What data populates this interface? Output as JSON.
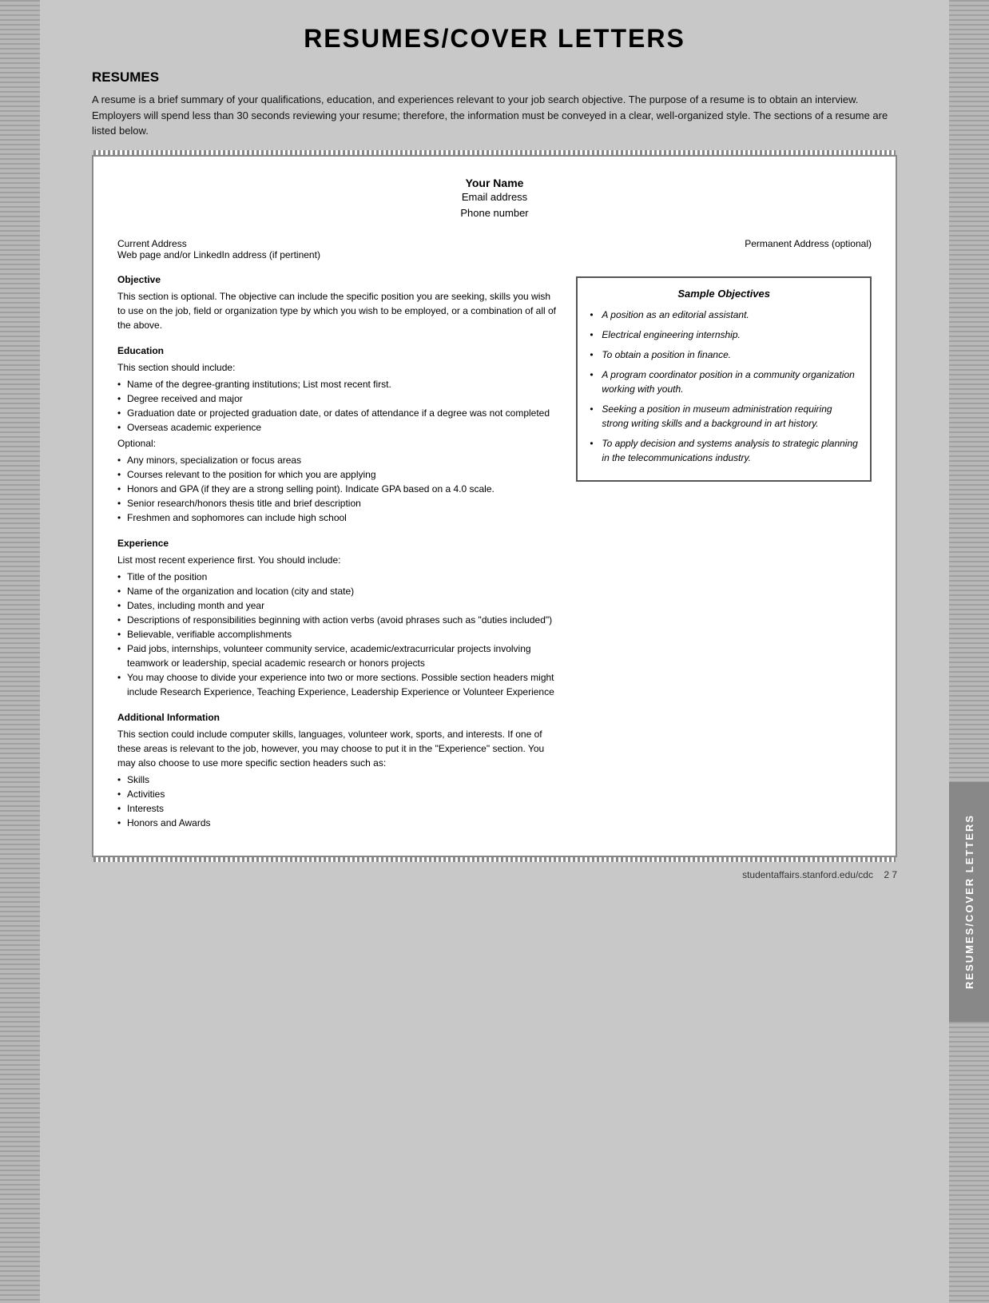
{
  "page": {
    "title": "RESUMES/COVER LETTERS",
    "footer_url": "studentaffairs.stanford.edu/cdc",
    "footer_page": "2 7"
  },
  "sidebar": {
    "vertical_text": "RESUMES/COVER LETTERS"
  },
  "resumes_section": {
    "heading": "RESUMES",
    "intro": "A resume is a brief summary of your qualifications, education, and experiences relevant to your job search objective. The purpose of a resume is to obtain an interview. Employers will spend less than 30 seconds reviewing your resume; therefore, the information must be conveyed in a clear, well-organized style. The sections of a resume are listed below."
  },
  "resume_template": {
    "name": "Your Name",
    "email": "Email address",
    "phone": "Phone number",
    "current_address": "Current Address",
    "web_page": "Web page and/or LinkedIn address (if pertinent)",
    "permanent_address": "Permanent Address (optional)"
  },
  "objective_section": {
    "title": "Objective",
    "text": "This section is optional. The objective can include the specific position you are seeking, skills you wish to use on the job, field or organization type by which you wish to be employed, or a combination of all of the above."
  },
  "education_section": {
    "title": "Education",
    "intro": "This section should include:",
    "required_items": [
      "Name of the degree-granting institutions; List most recent first.",
      "Degree received and major",
      "Graduation date or projected graduation date, or dates of attendance if a degree was not completed",
      "Overseas academic experience"
    ],
    "optional_label": "Optional:",
    "optional_items": [
      "Any minors, specialization or focus areas",
      "Courses relevant to the position for which you are applying",
      "Honors and GPA (if they are a strong selling point). Indicate GPA based on a 4.0 scale.",
      "Senior research/honors thesis title and brief description",
      "Freshmen and sophomores can include high school"
    ]
  },
  "experience_section": {
    "title": "Experience",
    "intro": "List most recent experience first. You should include:",
    "items": [
      "Title of the position",
      "Name of the organization and location (city and state)",
      "Dates, including month and year",
      "Descriptions of responsibilities beginning with action verbs (avoid phrases such as \"duties included\")",
      "Believable, verifiable accomplishments",
      "Paid jobs, internships, volunteer community service, academic/extracurricular projects involving teamwork or leadership, special academic research or honors projects",
      "You may choose to divide your experience into two or more sections. Possible section headers might include Research Experience, Teaching Experience, Leadership Experience or Volunteer Experience"
    ]
  },
  "additional_info_section": {
    "title": "Additional Information",
    "text": "This section could include computer skills, languages, volunteer work, sports, and interests. If one of these areas is relevant to the job, however, you may choose to put it in the \"Experience\" section. You may also choose to use more specific section headers such as:",
    "items": [
      "Skills",
      "Activities",
      "Interests",
      "Honors and Awards"
    ]
  },
  "sample_objectives": {
    "title": "Sample Objectives",
    "items": [
      "A position as an editorial assistant.",
      "Electrical engineering internship.",
      "To obtain a position in finance.",
      "A program coordinator position in a community organization working with youth.",
      "Seeking a position in museum administration requiring strong writing skills and a background in art history.",
      "To apply decision and systems analysis to strategic planning in the telecommunications industry."
    ]
  }
}
